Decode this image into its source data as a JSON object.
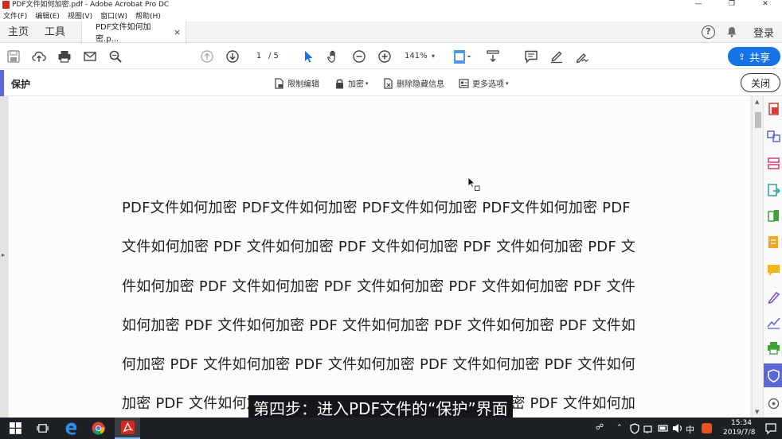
{
  "window": {
    "title": "PDF文件如何加密.pdf - Adobe Acrobat Pro DC",
    "controls": [
      "—",
      "❐",
      "✕"
    ]
  },
  "menu": [
    "文件(F)",
    "编辑(E)",
    "视图(V)",
    "窗口(W)",
    "帮助(H)"
  ],
  "tabs": {
    "home": "主页",
    "tools": "工具",
    "document": "PDF文件如何加密.p...",
    "close_glyph": "×",
    "help_glyph": "?",
    "login": "登录"
  },
  "toolbar": {
    "current_page": "1",
    "total_pages": "/ 5",
    "zoom": "141%",
    "share_label": "共享",
    "accent": "#1473e6"
  },
  "protect": {
    "title": "保护",
    "restrict_edit": "限制编辑",
    "encrypt": "加密",
    "remove_hidden": "删除隐藏信息",
    "more_options": "更多选项",
    "close_label": "关闭",
    "accent": "#5c67d6"
  },
  "document": {
    "lines": [
      "PDF文件如何加密 PDF文件如何加密 PDF文件如何加密 PDF文件如何加密 PDF",
      "文件如何加密 PDF 文件如何加密 PDF 文件如何加密 PDF 文件如何加密 PDF 文",
      "件如何加密 PDF 文件如何加密 PDF 文件如何加密 PDF 文件如何加密 PDF 文件",
      "如何加密 PDF 文件如何加密 PDF 文件如何加密 PDF 文件如何加密 PDF 文件如",
      "何加密 PDF 文件如何加密 PDF 文件如何加密 PDF 文件如何加密 PDF 文件如何",
      "加密 PDF 文件如何加密 PDF 文件如何加密 PDF 文件如何加密 PDF 文件如何加"
    ]
  },
  "subtitle": "第四步：进入PDF文件的“保护”界面",
  "taskbar": {
    "time": "15:34",
    "date": "2019/7/8",
    "ime": "中"
  }
}
